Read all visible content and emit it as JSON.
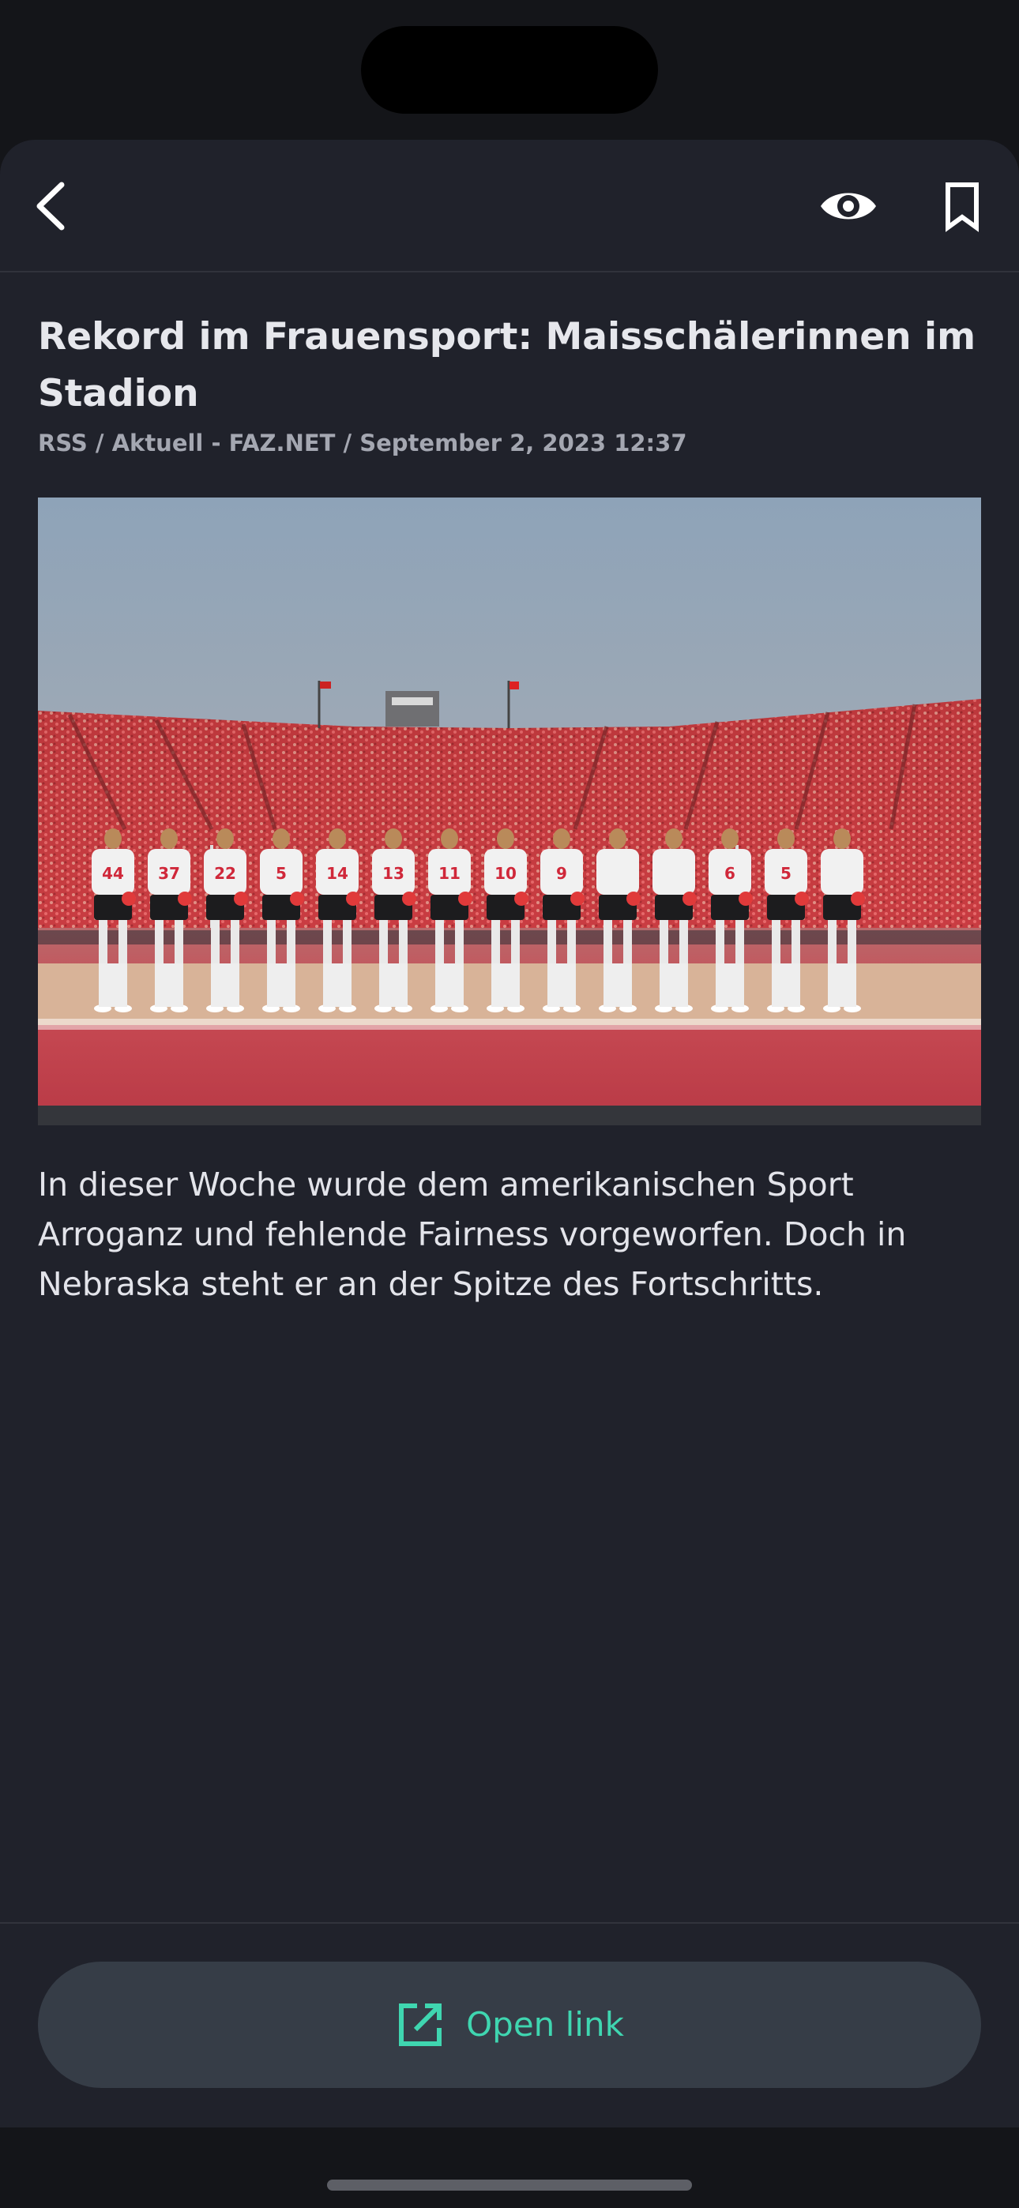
{
  "toolbar": {
    "back_icon": "chevron-left-icon",
    "visibility_icon": "eye-icon",
    "bookmark_icon": "bookmark-icon"
  },
  "article": {
    "title": "Rekord im Frauensport: Maisschälerinnen im Stadion",
    "meta": "RSS / Aktuell - FAZ.NET / September 2, 2023 12:37",
    "summary": "In dieser Woche wurde dem amerikanischen Sport Arroganz und fehlende Fairness vorgeworfen. Doch in Nebraska steht er an der Spitze des Fortschritts.",
    "image": {
      "jersey_numbers": [
        "44",
        "37",
        "22",
        "5",
        "14",
        "13",
        "11",
        "10",
        "9",
        "",
        "",
        "6",
        "5",
        ""
      ]
    }
  },
  "actions": {
    "open_link_label": "Open link",
    "open_link_icon": "external-link-icon"
  },
  "colors": {
    "background": "#20222b",
    "accent": "#3fd6b0",
    "button": "#363d47"
  }
}
